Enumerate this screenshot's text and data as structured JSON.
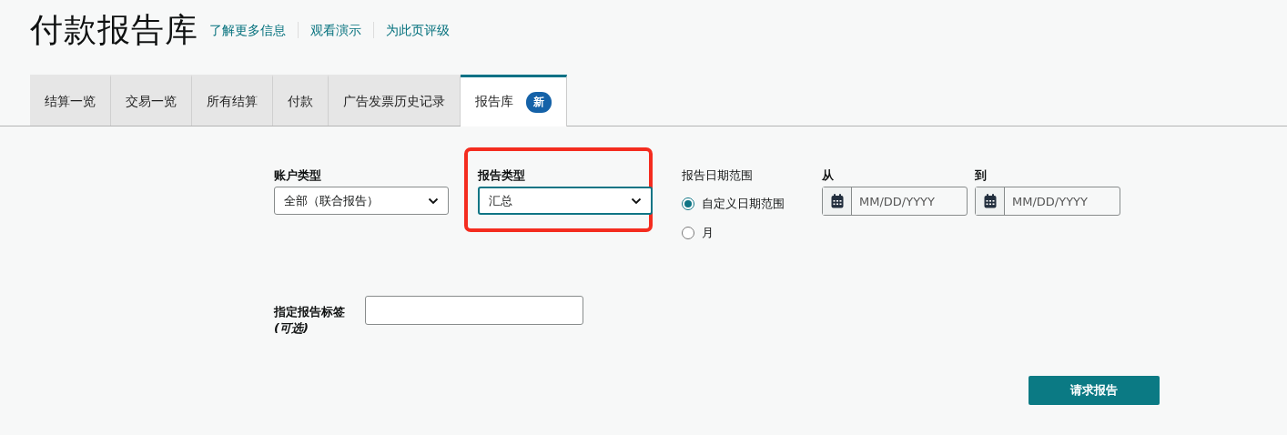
{
  "page": {
    "title": "付款报告库",
    "links": [
      "了解更多信息",
      "观看演示",
      "为此页评级"
    ]
  },
  "tabs": [
    {
      "label": "结算一览",
      "selected": false
    },
    {
      "label": "交易一览",
      "selected": false
    },
    {
      "label": "所有结算",
      "selected": false
    },
    {
      "label": "付款",
      "selected": false
    },
    {
      "label": "广告发票历史记录",
      "selected": false
    },
    {
      "label": "报告库",
      "selected": true,
      "badge": "新"
    }
  ],
  "form": {
    "account_type": {
      "label": "账户类型",
      "value": "全部（联合报告）",
      "highlighted": false
    },
    "report_type": {
      "label": "报告类型",
      "value": "汇总",
      "highlighted": true
    },
    "date_range": {
      "label": "报告日期范围",
      "options": [
        {
          "label": "自定义日期范围",
          "selected": true
        },
        {
          "label": "月",
          "selected": false
        }
      ]
    },
    "date_fields": [
      {
        "label": "从",
        "placeholder": "MM/DD/YYYY"
      },
      {
        "label": "到",
        "placeholder": "MM/DD/YYYY"
      }
    ],
    "tag": {
      "label": "指定报告标签",
      "hint": "(可选)"
    },
    "submit": "请求报告"
  }
}
